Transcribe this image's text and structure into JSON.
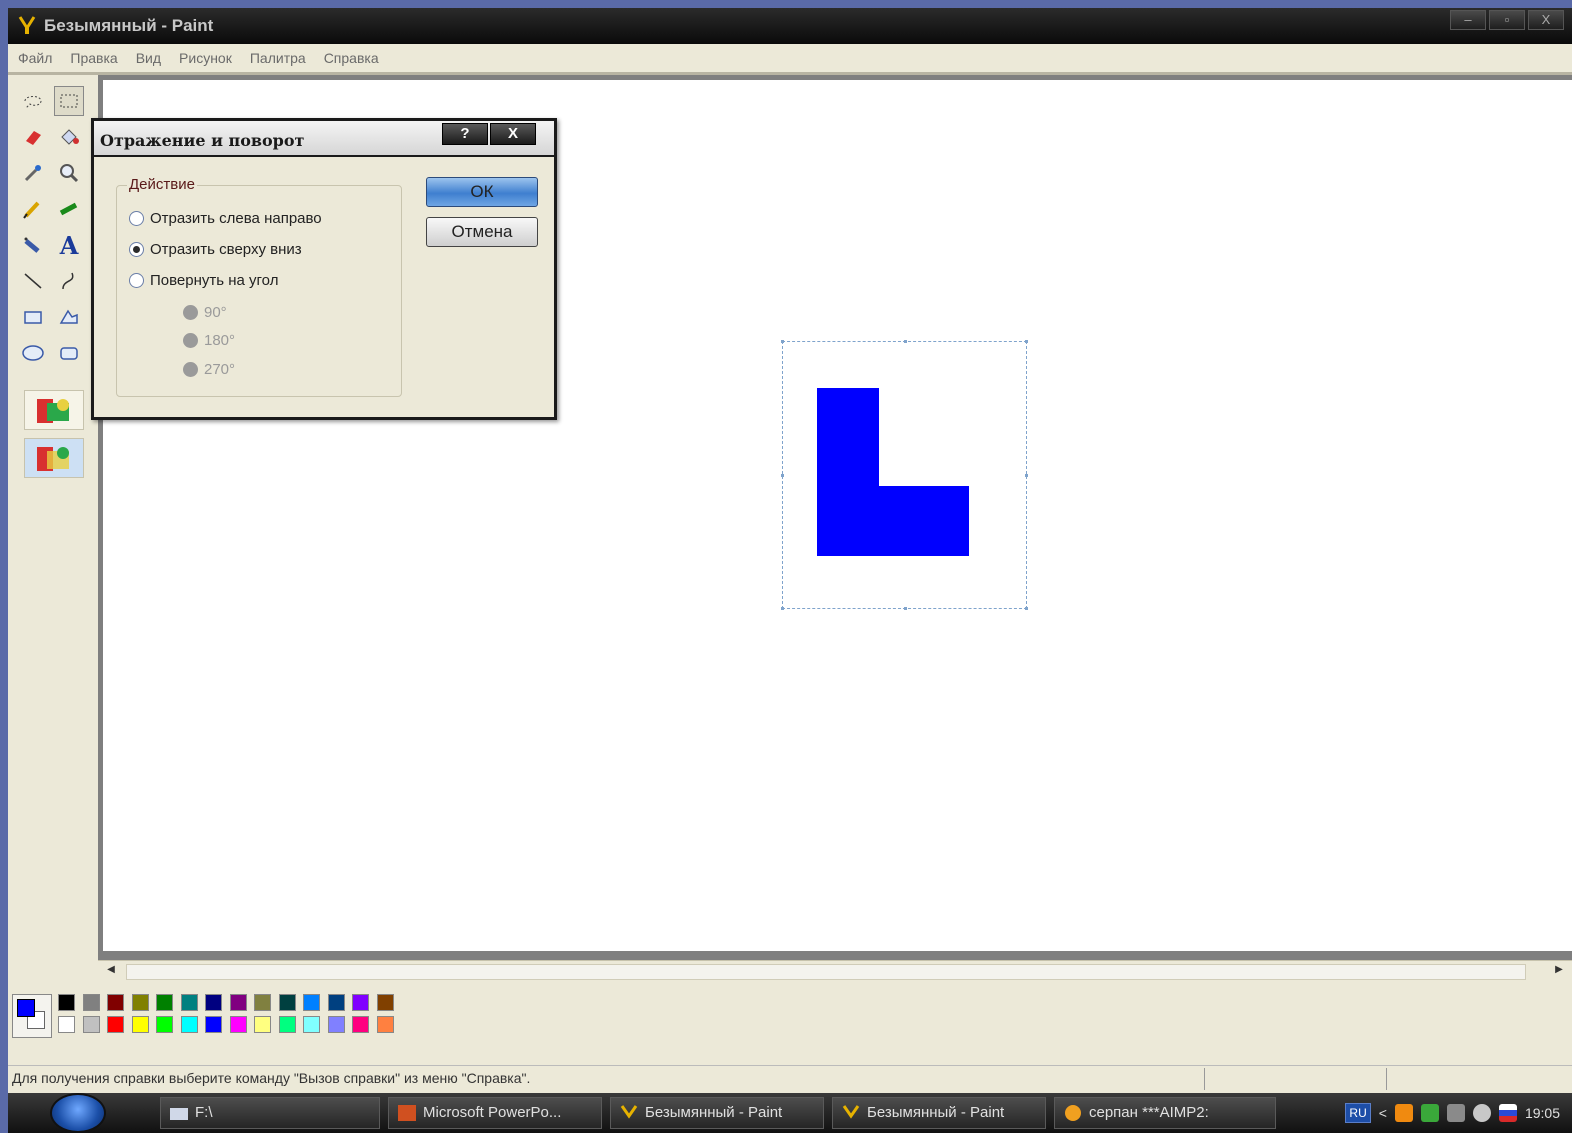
{
  "window": {
    "title": "Безымянный - Paint",
    "controls": {
      "minimize": "–",
      "maximize": "▫",
      "close": "X"
    }
  },
  "menu": [
    "Файл",
    "Правка",
    "Вид",
    "Рисунок",
    "Палитра",
    "Справка"
  ],
  "tools": [
    "free-select-icon",
    "rect-select-icon",
    "eraser-icon",
    "fill-icon",
    "color-picker-icon",
    "magnifier-icon",
    "pencil-icon",
    "brush-icon",
    "airbrush-icon",
    "text-icon",
    "line-icon",
    "curve-icon",
    "rectangle-icon",
    "polygon-icon",
    "ellipse-icon",
    "rounded-rect-icon"
  ],
  "tool_text_glyph": "A",
  "dialog": {
    "title": "Отражение и поворот",
    "help_button": "?",
    "close_button": "X",
    "group_label": "Действие",
    "options": [
      {
        "label": "Отразить слева направо",
        "checked": false
      },
      {
        "label": "Отразить сверху вниз",
        "checked": true
      },
      {
        "label": "Повернуть на угол",
        "checked": false
      }
    ],
    "angles": [
      "90°",
      "180°",
      "270°"
    ],
    "ok_label": "ОК",
    "cancel_label": "Отмена"
  },
  "canvas": {
    "shape_color": "#0000ff",
    "selection_color": "#7fa3cc"
  },
  "palette": {
    "foreground": "#0000ff",
    "background": "#ffffff",
    "top_row": [
      "#000000",
      "#808080",
      "#800000",
      "#808000",
      "#008000",
      "#008080",
      "#000080",
      "#800080",
      "#808040",
      "#004040",
      "#0080ff",
      "#004080",
      "#8000ff",
      "#804000"
    ],
    "bottom_row": [
      "#ffffff",
      "#c0c0c0",
      "#ff0000",
      "#ffff00",
      "#00ff00",
      "#00ffff",
      "#0000ff",
      "#ff00ff",
      "#ffff80",
      "#00ff80",
      "#80ffff",
      "#8080ff",
      "#ff0080",
      "#ff8040"
    ]
  },
  "status": {
    "message": "Для получения справки выберите команду \"Вызов справки\" из меню \"Справка\"."
  },
  "taskbar": {
    "items": [
      "F:\\",
      "Microsoft PowerPo...",
      "Безымянный - Paint",
      "Безымянный - Paint",
      "серпан ***AIMP2:"
    ],
    "language": "RU",
    "tray_arrow": "<",
    "clock": "19:05"
  }
}
